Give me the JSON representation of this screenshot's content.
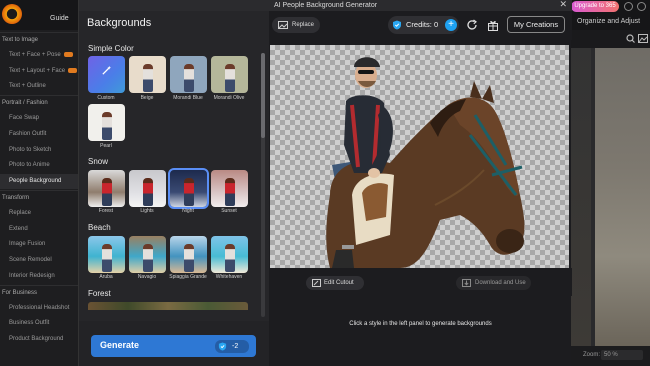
{
  "background_app": {
    "guide_label": "Guide",
    "upgrade_label": "Upgrade to 365",
    "organize_label": "Organize and Adjust",
    "zoom_label": "Zoom:",
    "zoom_value": "50 %",
    "sidebar": [
      {
        "label": "Text to Image",
        "type": "category",
        "badge": false
      },
      {
        "label": "Text + Face + Pose",
        "type": "item",
        "badge": true
      },
      {
        "label": "Text + Layout + Face",
        "type": "item",
        "badge": true
      },
      {
        "label": "Text + Outline",
        "type": "item",
        "badge": false
      },
      {
        "label": "Portrait / Fashion",
        "type": "category",
        "badge": false
      },
      {
        "label": "Face Swap",
        "type": "item",
        "badge": false
      },
      {
        "label": "Fashion Outfit",
        "type": "item",
        "badge": false
      },
      {
        "label": "Photo to Sketch",
        "type": "item",
        "badge": false
      },
      {
        "label": "Photo to Anime",
        "type": "item",
        "badge": false
      },
      {
        "label": "People Background",
        "type": "item",
        "badge": false,
        "active": true
      },
      {
        "label": "Transform",
        "type": "category",
        "badge": false
      },
      {
        "label": "Replace",
        "type": "item",
        "badge": false
      },
      {
        "label": "Extend",
        "type": "item",
        "badge": false
      },
      {
        "label": "Image Fusion",
        "type": "item",
        "badge": false
      },
      {
        "label": "Scene Remodel",
        "type": "item",
        "badge": false
      },
      {
        "label": "Interior Redesign",
        "type": "item",
        "badge": false
      },
      {
        "label": "For Business",
        "type": "category",
        "badge": false
      },
      {
        "label": "Professional Headshot",
        "type": "item",
        "badge": false
      },
      {
        "label": "Business Outfit",
        "type": "item",
        "badge": false
      },
      {
        "label": "Product Background",
        "type": "item",
        "badge": false
      }
    ]
  },
  "modal": {
    "title": "AI People Background Generator",
    "close_glyph": "✕",
    "panel_title": "Backgrounds",
    "sections": {
      "simple_color": "Simple Color",
      "snow": "Snow",
      "beach": "Beach",
      "forest": "Forest"
    },
    "simple_color_items": [
      "Custom",
      "Beige",
      "Morandi Blue",
      "Morandi Olive",
      "Pearl"
    ],
    "snow_items": [
      "Forest",
      "Lights",
      "Night",
      "Sunset"
    ],
    "beach_items": [
      "Aruba",
      "Navagio",
      "Spiaggia Grande",
      "Whitehaven"
    ],
    "selected_item": "Night",
    "generate_label": "Generate",
    "generate_cost": "-2",
    "replace_label": "Replace",
    "credits_label": "Credits:",
    "credits_value": "0",
    "plus_glyph": "+",
    "my_creations_label": "My Creations",
    "edit_cutout_label": "Edit Cutout",
    "download_label": "Download and Use",
    "hint_text": "Click a style in the left panel to generate backgrounds"
  },
  "colors": {
    "accent": "#2e78d4",
    "credit_plus": "#1ea1f1",
    "selected_outline": "#5a8ef5",
    "beige": "#e8dccb",
    "morandi_blue": "#8fa6bd",
    "morandi_olive": "#b5b79a",
    "pearl": "#f1f0ec"
  }
}
